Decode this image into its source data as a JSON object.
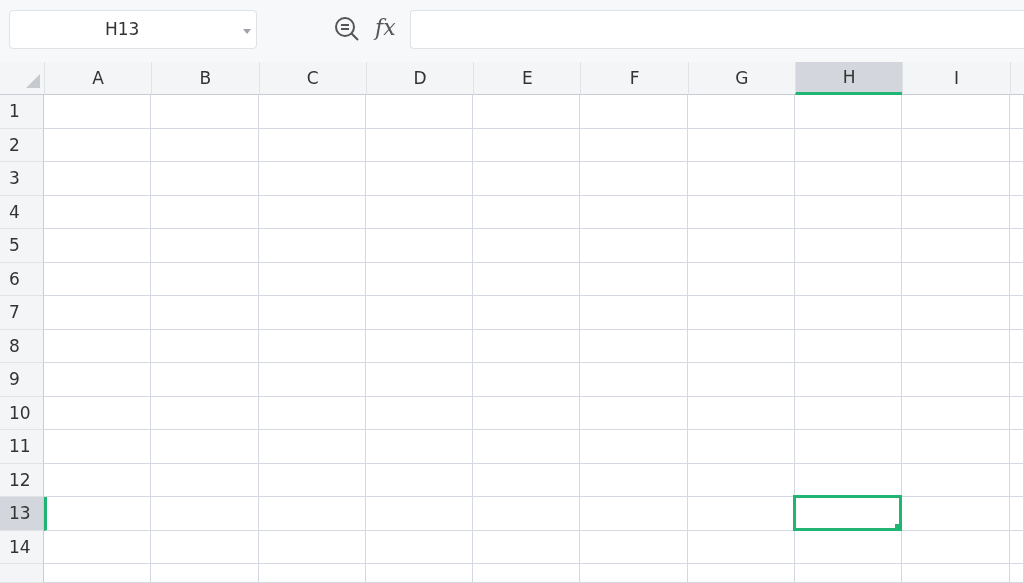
{
  "name_box": {
    "value": "H13"
  },
  "formula_bar": {
    "function_label": "fx"
  },
  "columns": [
    {
      "label": "A",
      "selected": false
    },
    {
      "label": "B",
      "selected": false
    },
    {
      "label": "C",
      "selected": false
    },
    {
      "label": "D",
      "selected": false
    },
    {
      "label": "E",
      "selected": false
    },
    {
      "label": "F",
      "selected": false
    },
    {
      "label": "G",
      "selected": false
    },
    {
      "label": "H",
      "selected": true
    },
    {
      "label": "I",
      "selected": false
    }
  ],
  "rows": [
    {
      "label": "1",
      "selected": false
    },
    {
      "label": "2",
      "selected": false
    },
    {
      "label": "3",
      "selected": false
    },
    {
      "label": "4",
      "selected": false
    },
    {
      "label": "5",
      "selected": false
    },
    {
      "label": "6",
      "selected": false
    },
    {
      "label": "7",
      "selected": false
    },
    {
      "label": "8",
      "selected": false
    },
    {
      "label": "9",
      "selected": false
    },
    {
      "label": "10",
      "selected": false
    },
    {
      "label": "11",
      "selected": false
    },
    {
      "label": "12",
      "selected": false
    },
    {
      "label": "13",
      "selected": true
    },
    {
      "label": "14",
      "selected": false
    }
  ]
}
